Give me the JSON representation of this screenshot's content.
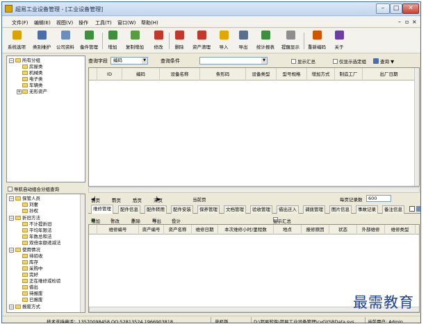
{
  "window": {
    "title": "超易工业设备管理 - [工业设备管理]",
    "minimize": "–",
    "maximize": "□",
    "close": "✕"
  },
  "menu": {
    "items": [
      "文件(F)",
      "编辑(E)",
      "视图(V)",
      "操作",
      "工具(T)",
      "窗口(W)",
      "帮助(H)"
    ],
    "mdi_controls": [
      "–",
      "▫",
      "×"
    ]
  },
  "toolbar": {
    "buttons": [
      {
        "label": "系统选项",
        "icon": "pencil-settings-icon",
        "color": "#d9a400"
      },
      {
        "label": "类别维护",
        "icon": "tools-icon",
        "color": "#4a6fa8"
      },
      {
        "label": "公司资料",
        "icon": "company-icon",
        "color": "#6c8fb9"
      },
      {
        "label": "备件管理",
        "icon": "parts-icon",
        "color": "#3f8f3f"
      },
      {
        "label": "增加",
        "icon": "add-icon",
        "color": "#3f8f3f"
      },
      {
        "label": "复制增加",
        "icon": "copy-add-icon",
        "color": "#5a9a40"
      },
      {
        "label": "修改",
        "icon": "edit-icon",
        "color": "#c0392b"
      },
      {
        "label": "删除",
        "icon": "delete-icon",
        "color": "#c0392b"
      },
      {
        "label": "资产清理",
        "icon": "clear-icon",
        "color": "#c0392b"
      },
      {
        "label": "导入",
        "icon": "import-icon",
        "color": "#e0a800"
      },
      {
        "label": "导出",
        "icon": "export-icon",
        "color": "#5b6f8a"
      },
      {
        "label": "统计报表",
        "icon": "report-icon",
        "color": "#3f8f3f"
      },
      {
        "label": "提醒显示",
        "icon": "reminder-icon",
        "color": "#8e8e8e"
      },
      {
        "label": "重新编码",
        "icon": "recode-icon",
        "color": "#d35400"
      },
      {
        "label": "关于",
        "icon": "help-icon",
        "color": "#6a3fa0"
      }
    ]
  },
  "tree": {
    "root": "所有分组",
    "children": [
      "房屋类",
      "机械类",
      "电子类",
      "车辆类",
      "无形资产"
    ]
  },
  "nav_autofilter": "导航自动组合分组查询",
  "left_bottom": {
    "sections": [
      {
        "title": "保管人员",
        "items": [
          "刘奢",
          "孙权"
        ]
      },
      {
        "title": "折旧方法",
        "items": [
          "不计提折旧",
          "平均年限法",
          "年数总和法",
          "双倍余额递减法"
        ]
      },
      {
        "title": "使用情况",
        "items": [
          "待验收",
          "库存",
          "采购中",
          "完好",
          "正在维修或检验",
          "借出",
          "待报废",
          "已报废"
        ]
      },
      {
        "title": "报废方式",
        "items": []
      }
    ]
  },
  "filter": {
    "field_label": "查询字段",
    "field_value": "编码",
    "condition_label": "查询条件",
    "condition_value": "",
    "show_summary": "显示汇总",
    "only_selected": "仅显示选定组",
    "query": "查询"
  },
  "main_grid": {
    "columns": [
      "ID",
      "编码",
      "设备名称",
      "条形码",
      "设备类型",
      "型号规格",
      "增加方式",
      "制造工厂",
      "出厂日期"
    ]
  },
  "pager": {
    "first": "首页",
    "prev": "前页",
    "next": "后页",
    "last": "末页",
    "current_page": "当前页",
    "per_page_label": "每页记录数",
    "per_page_value": "600"
  },
  "tabs": [
    "维修管理",
    "配件信息",
    "配件转用",
    "配件安装",
    "保养管理",
    "文档管理",
    "验收管理",
    "借出迁入",
    "调拨管理",
    "图片信息",
    "事故记录",
    "备注信息"
  ],
  "subtoolbar": {
    "add": "增加",
    "edit": "修改",
    "delete": "删除",
    "export": "导出",
    "design": "设计",
    "show_summary": "显示汇总"
  },
  "sub_grid": {
    "columns": [
      "维修编号",
      "资产编号",
      "资产名称",
      "维修日期",
      "本次维修小时/里程数",
      "地点",
      "报修原因",
      "状态",
      "外部维修",
      "维修类型"
    ]
  },
  "statusbar": {
    "support": "技术支持电话：13570098458 QQ:52813524 1966903818",
    "version": "单机版",
    "path": "D:\\超易软件\\超易工业设备管理\\cyGYSBData.sys",
    "user": "当前用户: Admin"
  },
  "watermark": "最需教育"
}
